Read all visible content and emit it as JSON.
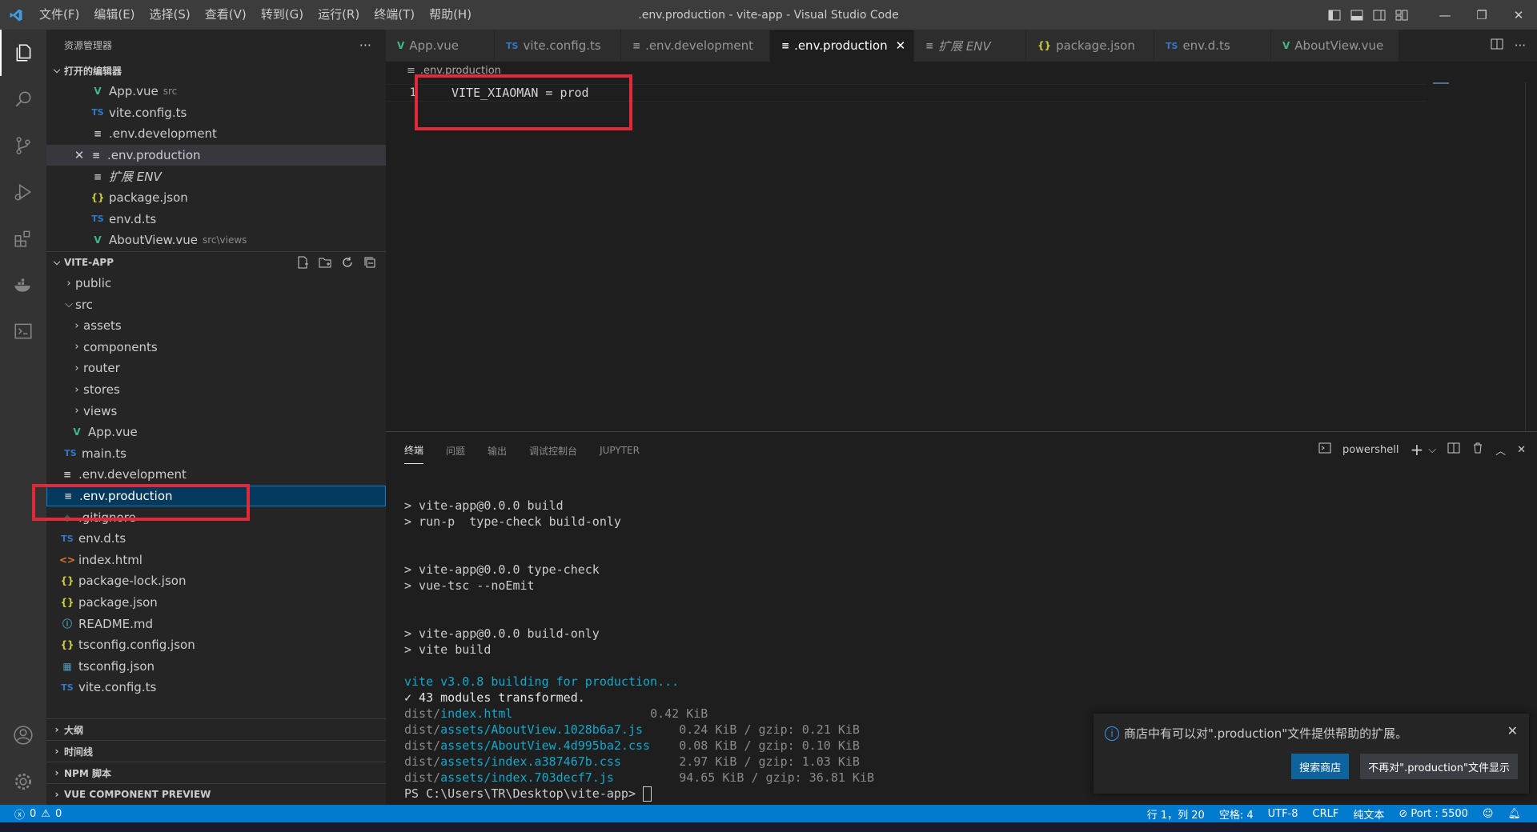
{
  "window": {
    "title": ".env.production - vite-app - Visual Studio Code",
    "menu": [
      "文件(F)",
      "编辑(E)",
      "选择(S)",
      "查看(V)",
      "转到(G)",
      "运行(R)",
      "终端(T)",
      "帮助(H)"
    ]
  },
  "sidebar": {
    "header": "资源管理器",
    "open_editors": {
      "title": "打开的编辑器",
      "items": [
        {
          "icon": "V",
          "name": "App.vue",
          "desc": "src"
        },
        {
          "icon": "TS",
          "name": "vite.config.ts",
          "desc": ""
        },
        {
          "icon": "≡",
          "name": ".env.development",
          "desc": ""
        },
        {
          "icon": "≡",
          "name": ".env.production",
          "desc": ""
        },
        {
          "icon": "≡",
          "name": "扩展 ENV",
          "desc": ""
        },
        {
          "icon": "{}",
          "name": "package.json",
          "desc": ""
        },
        {
          "icon": "TS",
          "name": "env.d.ts",
          "desc": ""
        },
        {
          "icon": "V",
          "name": "AboutView.vue",
          "desc": "src\\views"
        }
      ]
    },
    "project": {
      "title": "VITE-APP",
      "tree": [
        {
          "name": "public"
        },
        {
          "name": "src"
        },
        {
          "name": "assets"
        },
        {
          "name": "components"
        },
        {
          "name": "router"
        },
        {
          "name": "stores"
        },
        {
          "name": "views"
        },
        {
          "name": "App.vue"
        },
        {
          "name": "main.ts"
        },
        {
          "name": ".env.development"
        },
        {
          "name": ".env.production"
        },
        {
          "name": ".gitignore"
        },
        {
          "name": "env.d.ts"
        },
        {
          "name": "index.html"
        },
        {
          "name": "package-lock.json"
        },
        {
          "name": "package.json"
        },
        {
          "name": "README.md"
        },
        {
          "name": "tsconfig.config.json"
        },
        {
          "name": "tsconfig.json"
        },
        {
          "name": "vite.config.ts"
        }
      ]
    },
    "bottom_sections": [
      "大纲",
      "时间线",
      "NPM 脚本",
      "VUE COMPONENT PREVIEW"
    ]
  },
  "tabs": [
    {
      "icon": "V",
      "label": "App.vue"
    },
    {
      "icon": "TS",
      "label": "vite.config.ts"
    },
    {
      "icon": "≡",
      "label": ".env.development"
    },
    {
      "icon": "≡",
      "label": ".env.production"
    },
    {
      "icon": "≡",
      "label": "扩展 ENV"
    },
    {
      "icon": "{}",
      "label": "package.json"
    },
    {
      "icon": "TS",
      "label": "env.d.ts"
    },
    {
      "icon": "V",
      "label": "AboutView.vue"
    }
  ],
  "editor": {
    "breadcrumb": ".env.production",
    "line_number": "1",
    "code": "VITE_XIAOMAN = prod"
  },
  "panel": {
    "tabs": [
      "终端",
      "问题",
      "输出",
      "调试控制台",
      "JUPYTER"
    ],
    "shell": "powershell",
    "terminal": {
      "l1": "> vite-app@0.0.0 build",
      "l2": "> run-p  type-check build-only",
      "l3": "> vite-app@0.0.0 type-check",
      "l4": "> vue-tsc --noEmit",
      "l5": "> vite-app@0.0.0 build-only",
      "l6": "> vite build",
      "l7": "vite v3.0.8 building for production...",
      "l8": "✓ 43 modules transformed.",
      "files": [
        {
          "dir": "dist/",
          "file": "index.html",
          "size": "0.42 KiB"
        },
        {
          "dir": "dist/",
          "file": "assets/AboutView.1028b6a7.js",
          "size": "0.24 KiB / gzip: 0.21 KiB"
        },
        {
          "dir": "dist/",
          "file": "assets/AboutView.4d995ba2.css",
          "size": "0.08 KiB / gzip: 0.10 KiB"
        },
        {
          "dir": "dist/",
          "file": "assets/index.a387467b.css",
          "size": "2.97 KiB / gzip: 1.03 KiB"
        },
        {
          "dir": "dist/",
          "file": "assets/index.703decf7.js",
          "size": "94.65 KiB / gzip: 36.81 KiB"
        }
      ],
      "prompt": "PS C:\\Users\\TR\\Desktop\\vite-app> "
    }
  },
  "notification": {
    "message": "商店中有可以对\".production\"文件提供帮助的扩展。",
    "primary": "搜索商店",
    "secondary": "不再对\".production\"文件显示"
  },
  "statusbar": {
    "errors": "0",
    "warnings": "0",
    "position": "行 1，列 20",
    "spaces": "空格: 4",
    "encoding": "UTF-8",
    "eol": "CRLF",
    "language": "纯文本",
    "port": "Port : 5500"
  },
  "colors": {
    "accent": "#007acc",
    "highlight": "#e02a3a"
  }
}
